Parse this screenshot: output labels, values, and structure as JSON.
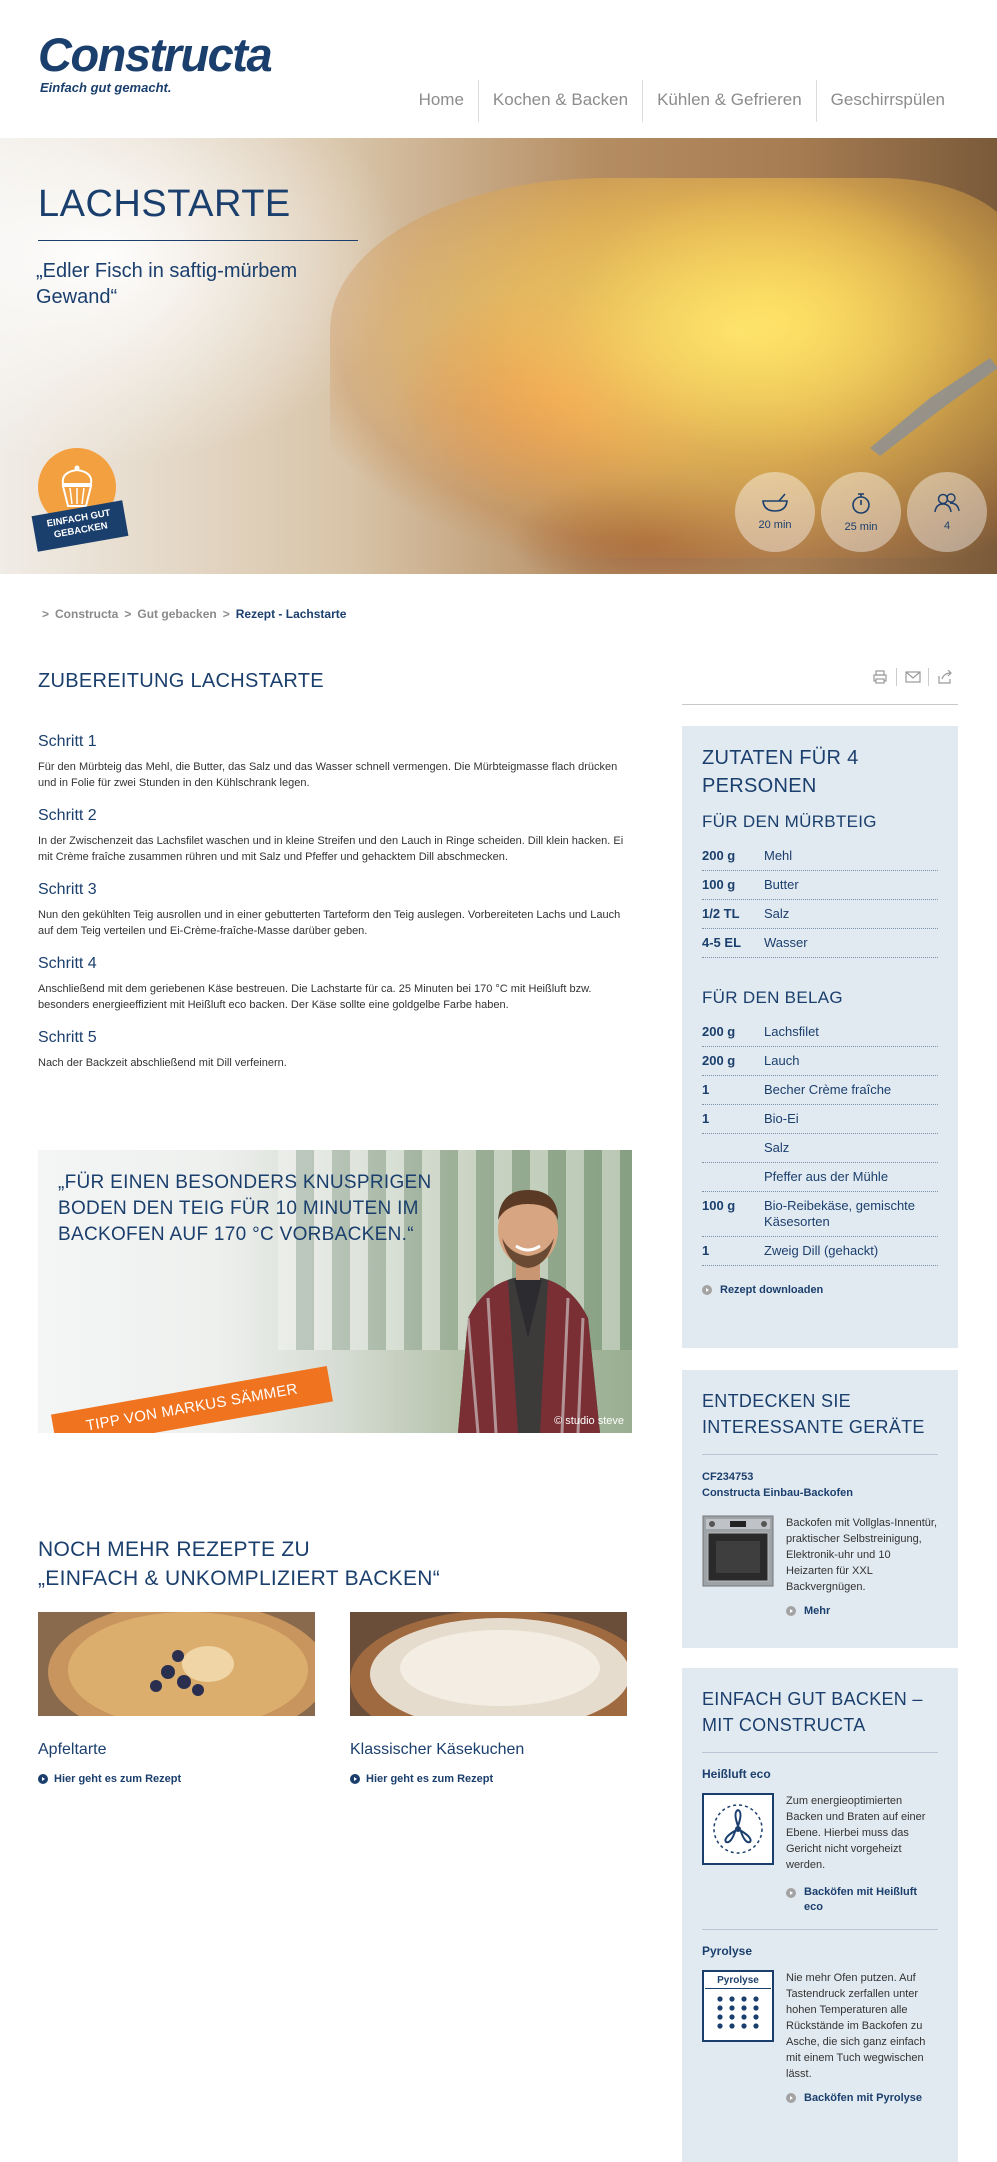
{
  "brand": {
    "logo_text": "Constructa",
    "tagline": "Einfach gut gemacht."
  },
  "nav": [
    "Home",
    "Kochen & Backen",
    "Kühlen & Gefrieren",
    "Geschirrspülen"
  ],
  "hero": {
    "title": "LACHSTARTE",
    "subtitle": "„Edler Fisch in saftig-mürbem Gewand“",
    "badge_text": "EINFACH GUT GEBACKEN",
    "stats": [
      {
        "icon": "bowl-icon",
        "label": "20 min"
      },
      {
        "icon": "timer-icon",
        "label": "25 min"
      },
      {
        "icon": "persons-icon",
        "label": "4"
      }
    ]
  },
  "breadcrumb": {
    "sep": ">",
    "items": [
      "Constructa",
      "Gut gebacken",
      "Rezept - Lachstarte"
    ]
  },
  "preparation": {
    "title": "ZUBEREITUNG LACHSTARTE",
    "steps": [
      {
        "title": "Schritt 1",
        "text": "Für den Mürbteig das Mehl, die Butter, das Salz und das Wasser schnell vermengen. Die Mürbteigmasse flach drücken und in Folie für zwei Stunden in den Kühlschrank legen."
      },
      {
        "title": "Schritt 2",
        "text": "In der Zwischenzeit das Lachsfilet waschen und in kleine Streifen und den Lauch in Ringe scheiden. Dill klein hacken. Ei mit Crème fraîche zusammen rühren und mit Salz und Pfeffer und gehacktem Dill abschmecken."
      },
      {
        "title": "Schritt 3",
        "text": "Nun den gekühlten Teig ausrollen und in einer gebutterten Tarteform den Teig auslegen. Vorbereiteten Lachs und Lauch auf dem Teig verteilen und Ei-Crème-fraîche-Masse darüber geben."
      },
      {
        "title": "Schritt 4",
        "text": "Anschließend mit dem geriebenen Käse bestreuen. Die Lachstarte für ca. 25 Minuten bei 170 °C mit Heißluft bzw. besonders energieeffizient mit Heißluft eco backen. Der Käse sollte eine goldgelbe Farbe haben."
      },
      {
        "title": "Schritt 5",
        "text": "Nach der Backzeit abschließend mit Dill verfeinern."
      }
    ]
  },
  "tip": {
    "quote": "„FÜR EINEN BESONDERS KNUSPRIGEN BODEN DEN TEIG FÜR 10 MINUTEN IM BACKOFEN AUF 170 °C VORBACKEN.“",
    "ribbon": "TIPP VON MARKUS SÄMMER",
    "credit": "© studio steve"
  },
  "more": {
    "title_line1": "NOCH MEHR REZEPTE ZU",
    "title_line2": "„EINFACH & UNKOMPLIZIERT BACKEN“",
    "recipes": [
      {
        "name": "Apfeltarte",
        "link": "Hier geht es zum Rezept"
      },
      {
        "name": "Klassischer Käsekuchen",
        "link": "Hier geht es zum Rezept"
      }
    ]
  },
  "ingredients": {
    "title": "ZUTATEN FÜR 4 PERSONEN",
    "groups": [
      {
        "title": "FÜR DEN MÜRBTEIG",
        "items": [
          {
            "qty": "200 g",
            "name": "Mehl"
          },
          {
            "qty": "100 g",
            "name": "Butter"
          },
          {
            "qty": "1/2 TL",
            "name": "Salz"
          },
          {
            "qty": "4-5 EL",
            "name": "Wasser"
          }
        ]
      },
      {
        "title": "FÜR DEN BELAG",
        "items": [
          {
            "qty": "200 g",
            "name": "Lachsfilet"
          },
          {
            "qty": "200 g",
            "name": "Lauch"
          },
          {
            "qty": "1",
            "name": "Becher Crème fraîche"
          },
          {
            "qty": "1",
            "name": "Bio-Ei"
          },
          {
            "qty": "",
            "name": "Salz"
          },
          {
            "qty": "",
            "name": "Pfeffer aus der Mühle"
          },
          {
            "qty": "100 g",
            "name": "Bio-Reibekäse, gemischte Käsesorten"
          },
          {
            "qty": "1",
            "name": "Zweig Dill (gehackt)"
          }
        ]
      }
    ],
    "download": "Rezept downloaden"
  },
  "devices": {
    "title": "ENTDECKEN SIE INTERESSANTE GERÄTE",
    "model": "CF234753",
    "name": "Constructa Einbau-Backofen",
    "desc": "Backofen mit Vollglas-Innentür, praktischer Selbstreinigung, Elektronik-uhr und 10 Heizarten für XXL Backvergnügen.",
    "more": "Mehr"
  },
  "baking": {
    "title": "EINFACH GUT BACKEN – MIT CONSTRUCTA",
    "features": [
      {
        "title": "Heißluft eco",
        "text": "Zum energieoptimierten Backen und Braten auf einer Ebene. Hierbei muss das Gericht nicht vorgeheizt werden.",
        "link": "Backöfen mit Heißluft eco"
      },
      {
        "title": "Pyrolyse",
        "icon_label": "Pyrolyse",
        "text": "Nie mehr Ofen putzen. Auf Tastendruck zerfallen unter hohen Temperaturen alle Rückstände im Backofen zu Asche, die sich ganz einfach mit einem Tuch wegwischen lässt.",
        "link": "Backöfen mit Pyrolyse"
      }
    ]
  },
  "colors": {
    "brand_blue": "#1b3f6d",
    "panel_bg": "#e2eaf1",
    "accent_orange": "#f0731f"
  }
}
